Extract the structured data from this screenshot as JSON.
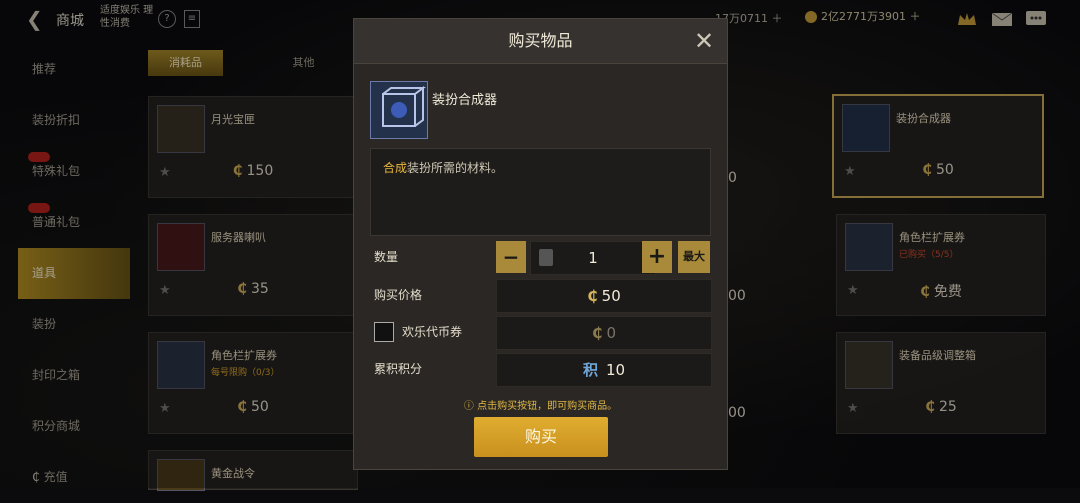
{
  "topbar": {
    "title": "商城",
    "notice": "适度娱乐 理性消费",
    "currency_1": "17万0711",
    "currency_2": "2亿2771万3901"
  },
  "sidebar": {
    "items": [
      {
        "label": "推荐"
      },
      {
        "label": "装扮折扣"
      },
      {
        "label": "特殊礼包"
      },
      {
        "label": "普通礼包"
      },
      {
        "label": "道具"
      },
      {
        "label": "装扮"
      },
      {
        "label": "封印之箱"
      },
      {
        "label": "积分商城"
      },
      {
        "label": "充值"
      }
    ]
  },
  "tabs": [
    {
      "label": "消耗品"
    },
    {
      "label": "其他"
    }
  ],
  "cards": [
    {
      "name": "月光宝匣",
      "price": "150"
    },
    {
      "name": "服务器喇叭",
      "price": "35"
    },
    {
      "name": "角色栏扩展券",
      "sub": "每号限购（0/3）",
      "price": "50"
    },
    {
      "name": "黄金战令",
      "price": ""
    },
    {
      "name": "装扮合成器",
      "price": "50"
    },
    {
      "name": "角色栏扩展券",
      "sub": "已购买（5/5）",
      "price": "免费"
    },
    {
      "name": "装备品级调整箱",
      "price": "25"
    }
  ],
  "mid_prices": [
    "0",
    "00",
    "00"
  ],
  "modal": {
    "title": "购买物品",
    "item_name": "装扮合成器",
    "desc_key": "合成",
    "desc_rest": "装扮所需的材料。",
    "qty_label": "数量",
    "qty_value": "1",
    "max_label": "最大",
    "price_label": "购买价格",
    "price_value": "50",
    "coupon_label": "欢乐代币券",
    "coupon_value": "0",
    "points_label": "累积积分",
    "points_icon": "积",
    "points_value": "10",
    "hint": "点击购买按钮，即可购买商品。",
    "buy_label": "购买"
  },
  "colors": {
    "accent": "#c9a23a",
    "button": "#d9a52a"
  }
}
